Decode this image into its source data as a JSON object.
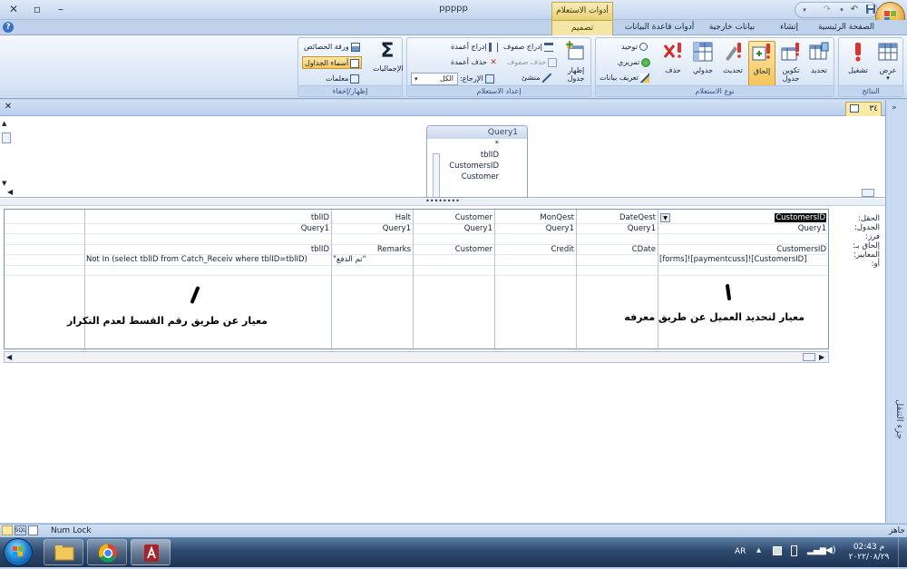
{
  "window": {
    "title": "ppppp",
    "context_tab_title": "أدوات الاستعلام",
    "controls": {
      "minimize": "–",
      "restore": "▫",
      "close": "✕"
    }
  },
  "tabs": [
    {
      "label": "الصفحة الرئيسية",
      "active": false
    },
    {
      "label": "إنشاء",
      "active": false
    },
    {
      "label": "بيانات خارجية",
      "active": false
    },
    {
      "label": "أدوات قاعدة البيانات",
      "active": false
    },
    {
      "label": "تصميم",
      "active": true
    }
  ],
  "ribbon": {
    "results": {
      "label": "النتائج",
      "view": "عرض",
      "run": "تشغيل"
    },
    "query_type": {
      "label": "نوع الاستعلام",
      "select": "تحديد",
      "make_table": "تكوين جدول",
      "append": "إلحاق",
      "update": "تحديث",
      "crosstab": "جدولي",
      "delete": "حذف",
      "union": "توحيد",
      "pass_through": "تمريري",
      "data_definition": "تعريف بيانات"
    },
    "query_setup": {
      "label": "إعداد الاستعلام",
      "show_table": "إظهار جدول",
      "insert_rows": "إدراج صفوف",
      "delete_rows": "حذف صفوف",
      "builder": "منشئ",
      "insert_columns": "إدراج أعمدة",
      "delete_columns": "حذف أعمدة",
      "return_label": "الإرجاع:",
      "return_value": "الكل"
    },
    "show_hide": {
      "label": "إظهار/إخفاء",
      "totals": "الإجماليات",
      "property_sheet": "ورقة الخصائص",
      "table_names": "أسماء الجداول",
      "parameters": "معلمات"
    }
  },
  "document": {
    "tab_label": "٣٤"
  },
  "table_box": {
    "name": "Query1",
    "fields": [
      "*",
      "tblID",
      "CustomersID",
      "Customer"
    ]
  },
  "grid": {
    "row_labels": [
      "الحقل:",
      "الجدول:",
      "فرز:",
      "إلحاق بـ:",
      "المعايير:",
      "أو:"
    ],
    "columns": [
      {
        "field": "CustomersID",
        "table": "Query1",
        "sort": "",
        "append_to": "CustomersID",
        "criteria": "[forms]![paymentcuss]![CustomersID]"
      },
      {
        "field": "DateQest",
        "table": "Query1",
        "sort": "",
        "append_to": "CDate",
        "criteria": ""
      },
      {
        "field": "MonQest",
        "table": "Query1",
        "sort": "",
        "append_to": "Credit",
        "criteria": ""
      },
      {
        "field": "Customer",
        "table": "Query1",
        "sort": "",
        "append_to": "Customer",
        "criteria": ""
      },
      {
        "field": "Halt",
        "table": "Query1",
        "sort": "",
        "append_to": "Remarks",
        "criteria": "\"تم الدفع\""
      },
      {
        "field": "tblID",
        "table": "Query1",
        "sort": "",
        "append_to": "tblID",
        "criteria": "Not In (select tblID from Catch_Receiv where tblID=tblID)"
      },
      {
        "field": "",
        "table": "",
        "sort": "",
        "append_to": "",
        "criteria": ""
      }
    ]
  },
  "annotations": {
    "right": "معيار لتحديد العميل عن طريق معرفه",
    "left": "معيار عن طريق رقم القسط لعدم التكرار"
  },
  "statusbar": {
    "ready": "جاهز",
    "num_lock": "Num Lock"
  },
  "taskbar": {
    "language": "AR",
    "time": "م 02:43",
    "date": "٢٠٢٢/٠٨/٢٩"
  }
}
